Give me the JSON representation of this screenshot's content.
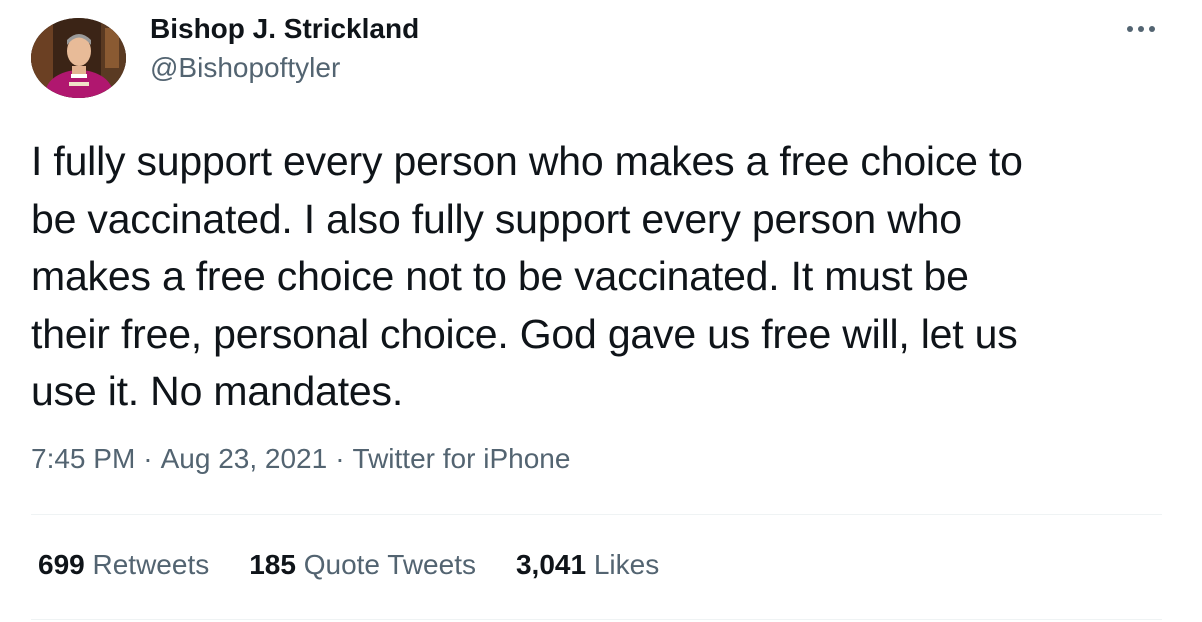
{
  "tweet": {
    "author": {
      "display_name": "Bishop J. Strickland",
      "handle": "@Bishopoftyler"
    },
    "text": "I fully support every person who makes a free choice to\nbe vaccinated. I also fully support every person who\nmakes a free choice not to be vaccinated. It must be\ntheir free, personal choice. God gave us free will, let us\nuse it. No mandates.",
    "time": "7:45 PM",
    "date": "Aug 23, 2021",
    "separator": "·",
    "source": "Twitter for iPhone",
    "more_icon": "more-horizontal-icon"
  },
  "stats": {
    "retweets": {
      "count": "699",
      "label": "Retweets"
    },
    "quotes": {
      "count": "185",
      "label": "Quote Tweets"
    },
    "likes": {
      "count": "3,041",
      "label": "Likes"
    }
  },
  "colors": {
    "primary_text": "#0f1419",
    "secondary_text": "#536471",
    "divider": "#eff3f4",
    "background": "#ffffff"
  }
}
